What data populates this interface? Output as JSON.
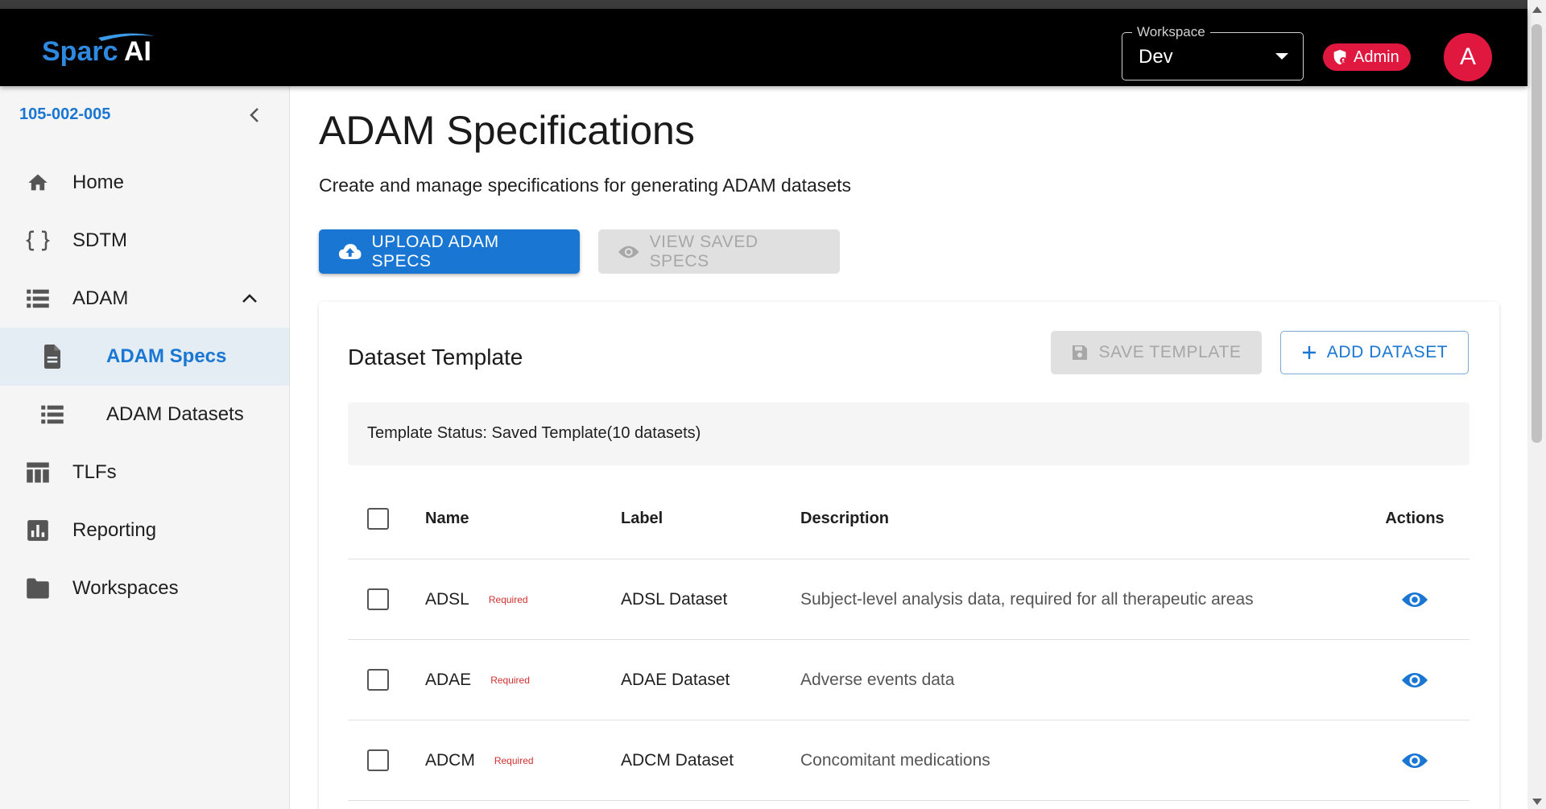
{
  "app": {
    "logo_text": "Sparc AI",
    "workspace": {
      "legend": "Workspace",
      "value": "Dev"
    },
    "admin_label": "Admin",
    "avatar_initial": "A"
  },
  "sidebar": {
    "study_id": "105-002-005",
    "items": [
      {
        "label": "Home",
        "icon": "home-icon"
      },
      {
        "label": "SDTM",
        "icon": "braces-icon"
      },
      {
        "label": "ADAM",
        "icon": "list-icon",
        "expanded": true
      },
      {
        "label": "ADAM Specs",
        "icon": "document-icon",
        "active": true
      },
      {
        "label": "ADAM Datasets",
        "icon": "list-icon"
      },
      {
        "label": "TLFs",
        "icon": "table-icon"
      },
      {
        "label": "Reporting",
        "icon": "bar-chart-icon"
      },
      {
        "label": "Workspaces",
        "icon": "folder-icon"
      }
    ]
  },
  "main": {
    "title": "ADAM Specifications",
    "subtitle": "Create and manage specifications for generating ADAM datasets",
    "upload_label": "UPLOAD ADAM SPECS",
    "view_saved_label": "VIEW SAVED SPECS"
  },
  "card": {
    "title": "Dataset Template",
    "save_template_label": "SAVE TEMPLATE",
    "add_dataset_label": "ADD DATASET",
    "status": "Template Status: Saved Template(10 datasets)",
    "columns": [
      "Name",
      "Label",
      "Description",
      "Actions"
    ],
    "rows": [
      {
        "name": "ADSL",
        "badge": "Required",
        "label": "ADSL Dataset",
        "description": "Subject-level analysis data, required for all therapeutic areas"
      },
      {
        "name": "ADAE",
        "badge": "Required",
        "label": "ADAE Dataset",
        "description": "Adverse events data"
      },
      {
        "name": "ADCM",
        "badge": "Required",
        "label": "ADCM Dataset",
        "description": "Concomitant medications"
      }
    ]
  },
  "colors": {
    "primary": "#1976d2",
    "appbar": "#000000",
    "accent_red": "#e0183f",
    "required_text": "#d32f2f",
    "sidebar_bg": "#f5f5f5",
    "active_bg": "#e4ecf4"
  }
}
